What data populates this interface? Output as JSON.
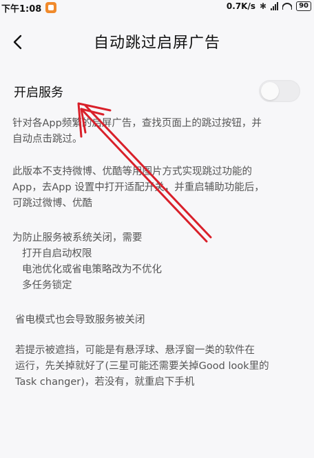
{
  "status_bar": {
    "time": "下午1:08",
    "net_speed": "0.7K/s",
    "battery": "90"
  },
  "header": {
    "title": "自动跳过启屏广告"
  },
  "service": {
    "label": "开启服务",
    "enabled": false
  },
  "description": {
    "p1_line1": "针对各App频繁的启屏广告，查找页面上的跳过按钮，并",
    "p1_line2": "自动点击跳过。",
    "p2_line1": "此版本不支持微博、优酷等用图片方式实现跳过功能的",
    "p2_line2": "App，去App 设置中打开适配开关，并重启辅助功能后，",
    "p2_line3": "可跳过微博、优酷",
    "p3_title": "为防止服务被系统关闭，需要",
    "p3_item1": "打开自启动权限",
    "p3_item2": "电池优化或省电策略改为不优化",
    "p3_item3": "多任务锁定",
    "p4": "省电模式也会导致服务被关闭",
    "p5_line1": "若提示被遮挡，可能是有悬浮球、悬浮窗一类的软件在",
    "p5_line2": "运行，先关掉就好了(三星可能还需要关掉Good look里的",
    "p5_line3": "Task changer)，若没有，就重启下手机"
  },
  "annotation": {
    "arrow_color": "#d9202a"
  }
}
